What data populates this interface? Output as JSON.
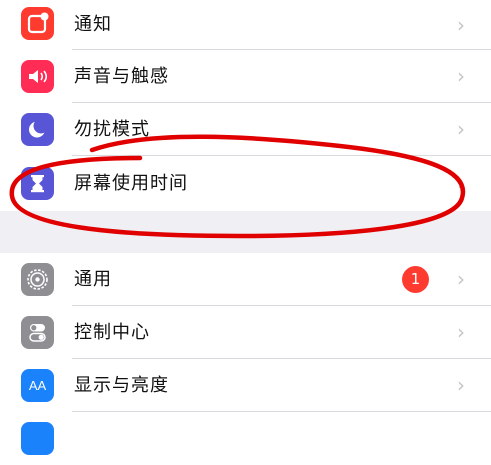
{
  "colors": {
    "background": "#efeff4",
    "badge": "#ff3b30",
    "annotation": "#e00000"
  },
  "group1": {
    "items": [
      {
        "label": "通知",
        "icon": "notifications-icon",
        "color": "#ff3b30"
      },
      {
        "label": "声音与触感",
        "icon": "sound-icon",
        "color": "#ff2d55"
      },
      {
        "label": "勿扰模式",
        "icon": "moon-icon",
        "color": "#5856d6"
      },
      {
        "label": "屏幕使用时间",
        "icon": "hourglass-icon",
        "color": "#5856d6"
      }
    ]
  },
  "group2": {
    "items": [
      {
        "label": "通用",
        "icon": "gear-icon",
        "color": "#8e8e93",
        "badge": "1"
      },
      {
        "label": "控制中心",
        "icon": "toggles-icon",
        "color": "#8e8e93"
      },
      {
        "label": "显示与亮度",
        "icon": "display-icon",
        "color": "#1a82fb",
        "icon_text": "AA"
      }
    ]
  },
  "chevron": "›"
}
